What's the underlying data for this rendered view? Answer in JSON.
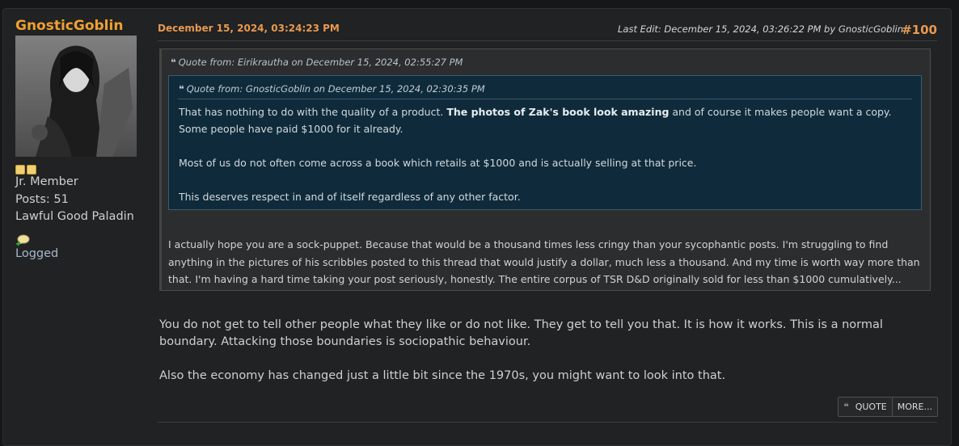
{
  "poster": {
    "name": "GnosticGoblin",
    "rank": "Jr. Member",
    "posts": "Posts: 51",
    "title": "Lawful Good Paladin",
    "status": "Logged"
  },
  "post": {
    "date": "December 15, 2024, 03:24:23 PM",
    "last_edit": "Last Edit: December 15, 2024, 03:26:22 PM by GnosticGoblin",
    "number": "#100"
  },
  "quote_outer": {
    "header": "Quote from: Eirikrautha on December 15, 2024, 02:55:27 PM",
    "body": "I actually hope you are a sock-puppet.  Because that would be a thousand times less cringy than your sycophantic posts.  I'm struggling to find anything in the pictures of his scribbles posted to this thread that would justify a dollar, much less a thousand.  And my time is worth way more than that.  I'm having a hard time taking your post seriously, honestly.  The entire corpus of TSR D&D originally sold for less than $1000 cumulatively..."
  },
  "quote_inner": {
    "header": "Quote from: GnosticGoblin on December 15, 2024, 02:30:35 PM",
    "p1_before": "That has nothing to do with the quality of a product. ",
    "p1_bold": "The photos of Zak's book look amazing",
    "p1_after": " and of course it makes people want a copy. Some people have paid $1000 for it already.",
    "p2": "Most of us do not often come across a book which retails at $1000 and is actually selling at that price.",
    "p3": "This deserves respect in and of itself regardless of any other factor."
  },
  "reply": {
    "p1": "You do not get to tell other people what they like or do not like. They get to tell you that. It is how it works. This is a normal boundary. Attacking those boundaries is sociopathic behaviour.",
    "p2": "Also the economy has changed just a little bit since the 1970s, you might want to look into that."
  },
  "buttons": {
    "quote": "QUOTE",
    "more": "MORE..."
  },
  "icons": {
    "quote_glyph": "❝",
    "stars": [
      "star-icon",
      "star-icon"
    ],
    "pm": "message-bubble-icon"
  },
  "colors": {
    "username": "#f0a030",
    "date": "#e89850",
    "inner_quote_bg": "#0f2b3b",
    "outer_quote_bg": "#2b2d2f"
  }
}
